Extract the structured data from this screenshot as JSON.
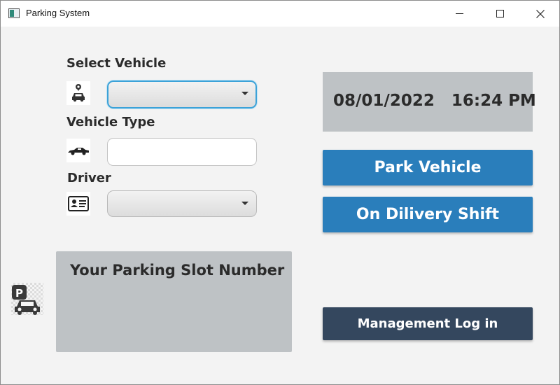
{
  "window": {
    "title": "Parking System"
  },
  "form": {
    "select_vehicle_label": "Select Vehicle",
    "select_vehicle_value": "",
    "vehicle_type_label": "Vehicle Type",
    "vehicle_type_value": "",
    "driver_label": "Driver",
    "driver_value": ""
  },
  "datetime": {
    "date": "08/01/2022",
    "time": "16:24 PM"
  },
  "actions": {
    "park_vehicle": "Park Vehicle",
    "delivery_shift": "On Dilivery Shift",
    "management_login": "Management Log in"
  },
  "slot": {
    "title": "Your Parking Slot Number",
    "number": ""
  },
  "icons": {
    "select_vehicle": "car-location-icon",
    "vehicle_type": "car-side-icon",
    "driver": "id-card-icon",
    "logo": "parking-car-icon"
  },
  "colors": {
    "primary": "#2a7ebb",
    "management": "#34475e",
    "panel": "#bec2c5",
    "focus": "#3ca2d8"
  }
}
